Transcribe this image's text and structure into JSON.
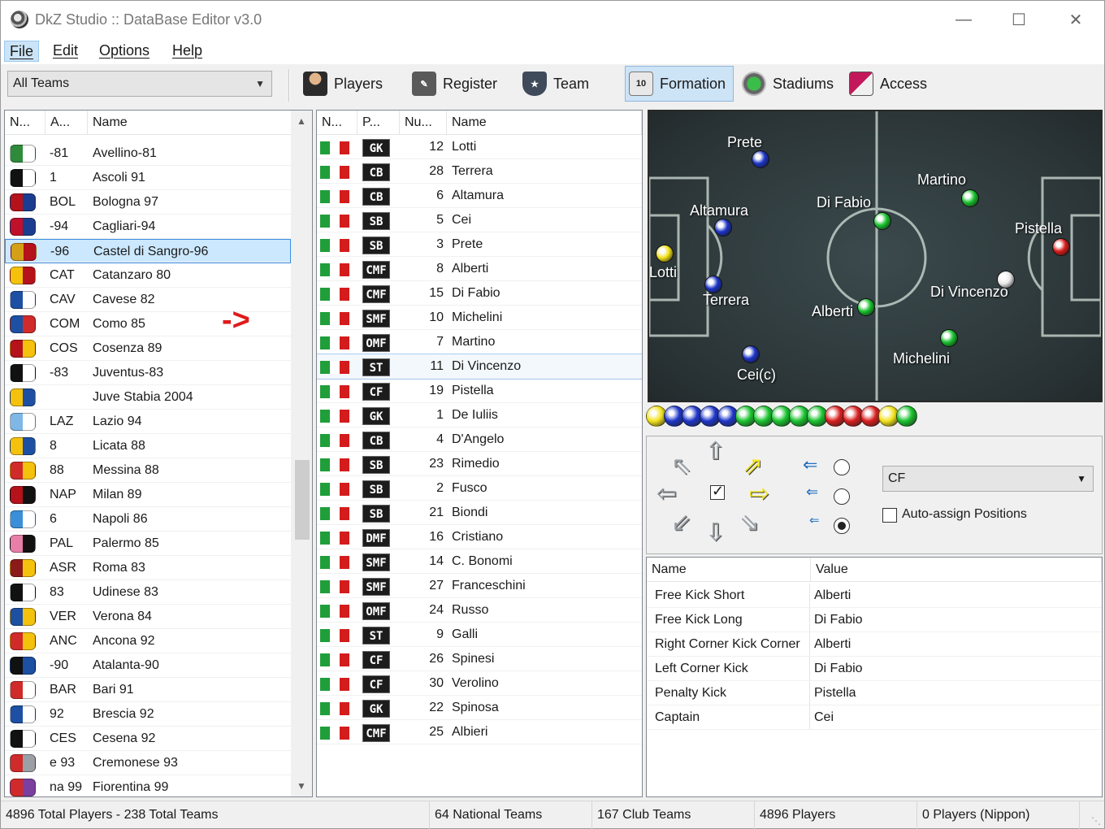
{
  "window": {
    "title": "DkZ Studio :: DataBase Editor v3.0",
    "minimize": "—",
    "maximize": "☐",
    "close": "✕"
  },
  "menu": [
    "File",
    "Edit",
    "Options",
    "Help"
  ],
  "toolbar": {
    "team_filter": "All Teams",
    "buttons": [
      {
        "label": "Players",
        "icon": "player-icon"
      },
      {
        "label": "Register",
        "icon": "register-icon"
      },
      {
        "label": "Team",
        "icon": "team-shield-icon"
      },
      {
        "label": "Formation",
        "icon": "formation-icon",
        "badge": "10",
        "pressed": true
      },
      {
        "label": "Stadiums",
        "icon": "stadium-icon"
      },
      {
        "label": "Access",
        "icon": "access-icon"
      }
    ]
  },
  "teams_table": {
    "columns": [
      "N...",
      "A...",
      "Name"
    ],
    "rows": [
      {
        "abbr": "-81",
        "name": "Avellino-81",
        "crest": [
          "#2e8b3a",
          "#ffffff"
        ]
      },
      {
        "abbr": "1",
        "name": "Ascoli 91",
        "crest": [
          "#111111",
          "#ffffff"
        ]
      },
      {
        "abbr": "BOL",
        "name": "Bologna 97",
        "crest": [
          "#b5121b",
          "#1b3d8f"
        ]
      },
      {
        "abbr": "-94",
        "name": "Cagliari-94",
        "crest": [
          "#c0102a",
          "#1b3d8f"
        ]
      },
      {
        "abbr": "-96",
        "name": "Castel di Sangro-96",
        "crest": [
          "#d4a017",
          "#b5121b"
        ],
        "selected": true
      },
      {
        "abbr": "CAT",
        "name": "Catanzaro 80",
        "crest": [
          "#f4c20d",
          "#b5121b"
        ]
      },
      {
        "abbr": "CAV",
        "name": "Cavese 82",
        "crest": [
          "#1d4fa3",
          "#ffffff"
        ]
      },
      {
        "abbr": "COM",
        "name": "Como 85",
        "crest": [
          "#1d4fa3",
          "#d12a2a"
        ]
      },
      {
        "abbr": "COS",
        "name": "Cosenza 89",
        "crest": [
          "#b5121b",
          "#f4c20d"
        ]
      },
      {
        "abbr": "-83",
        "name": "Juventus-83",
        "crest": [
          "#111111",
          "#ffffff"
        ]
      },
      {
        "abbr": "",
        "name": "Juve Stabia 2004",
        "crest": [
          "#f4c20d",
          "#1d4fa3"
        ]
      },
      {
        "abbr": "LAZ",
        "name": "Lazio 94",
        "crest": [
          "#7fb8e6",
          "#ffffff"
        ]
      },
      {
        "abbr": "8",
        "name": "Licata 88",
        "crest": [
          "#f4c20d",
          "#1d4fa3"
        ]
      },
      {
        "abbr": "88",
        "name": "Messina 88",
        "crest": [
          "#d12a2a",
          "#f4c20d"
        ]
      },
      {
        "abbr": "NAP",
        "name": "Milan 89",
        "crest": [
          "#b5121b",
          "#111111"
        ]
      },
      {
        "abbr": "6",
        "name": "Napoli 86",
        "crest": [
          "#3a8fd8",
          "#ffffff"
        ]
      },
      {
        "abbr": "PAL",
        "name": "Palermo 85",
        "crest": [
          "#e87fa8",
          "#111111"
        ]
      },
      {
        "abbr": "ASR",
        "name": "Roma 83",
        "crest": [
          "#8b1a1a",
          "#f4c20d"
        ]
      },
      {
        "abbr": "83",
        "name": "Udinese 83",
        "crest": [
          "#111111",
          "#ffffff"
        ]
      },
      {
        "abbr": "VER",
        "name": "Verona 84",
        "crest": [
          "#1d4fa3",
          "#f4c20d"
        ]
      },
      {
        "abbr": "ANC",
        "name": "Ancona 92",
        "crest": [
          "#d12a2a",
          "#f4c20d"
        ]
      },
      {
        "abbr": "-90",
        "name": "Atalanta-90",
        "crest": [
          "#111111",
          "#1d4fa3"
        ]
      },
      {
        "abbr": "BAR",
        "name": "Bari 91",
        "crest": [
          "#d12a2a",
          "#ffffff"
        ]
      },
      {
        "abbr": "92",
        "name": "Brescia 92",
        "crest": [
          "#1d4fa3",
          "#ffffff"
        ]
      },
      {
        "abbr": "CES",
        "name": "Cesena 92",
        "crest": [
          "#111111",
          "#ffffff"
        ]
      },
      {
        "abbr": "e 93",
        "name": "Cremonese 93",
        "crest": [
          "#d12a2a",
          "#9aa0a6"
        ]
      },
      {
        "abbr": "na 99",
        "name": "Fiorentina 99",
        "crest": [
          "#d12a2a",
          "#7b3fa0"
        ]
      }
    ]
  },
  "annotation_arrow": "->",
  "players_table": {
    "columns": [
      "N...",
      "P...",
      "Nu...",
      "Name"
    ],
    "rows": [
      {
        "pos": "GK",
        "num": "12",
        "name": "Lotti"
      },
      {
        "pos": "CB",
        "num": "28",
        "name": "Terrera"
      },
      {
        "pos": "CB",
        "num": "6",
        "name": "Altamura"
      },
      {
        "pos": "SB",
        "num": "5",
        "name": "Cei"
      },
      {
        "pos": "SB",
        "num": "3",
        "name": "Prete"
      },
      {
        "pos": "CMF",
        "num": "8",
        "name": "Alberti"
      },
      {
        "pos": "CMF",
        "num": "15",
        "name": "Di Fabio"
      },
      {
        "pos": "SMF",
        "num": "10",
        "name": "Michelini"
      },
      {
        "pos": "OMF",
        "num": "7",
        "name": "Martino"
      },
      {
        "pos": "ST",
        "num": "11",
        "name": "Di Vincenzo",
        "selected": true
      },
      {
        "pos": "CF",
        "num": "19",
        "name": "Pistella"
      },
      {
        "pos": "GK",
        "num": "1",
        "name": "De Iuliis"
      },
      {
        "pos": "CB",
        "num": "4",
        "name": "D'Angelo"
      },
      {
        "pos": "SB",
        "num": "23",
        "name": "Rimedio"
      },
      {
        "pos": "SB",
        "num": "2",
        "name": "Fusco"
      },
      {
        "pos": "SB",
        "num": "21",
        "name": "Biondi"
      },
      {
        "pos": "DMF",
        "num": "16",
        "name": "Cristiano"
      },
      {
        "pos": "SMF",
        "num": "14",
        "name": "C. Bonomi"
      },
      {
        "pos": "SMF",
        "num": "27",
        "name": "Franceschini"
      },
      {
        "pos": "OMF",
        "num": "24",
        "name": "Russo"
      },
      {
        "pos": "ST",
        "num": "9",
        "name": "Galli"
      },
      {
        "pos": "CF",
        "num": "26",
        "name": "Spinesi"
      },
      {
        "pos": "CF",
        "num": "30",
        "name": "Verolino"
      },
      {
        "pos": "GK",
        "num": "22",
        "name": "Spinosa"
      },
      {
        "pos": "CMF",
        "num": "25",
        "name": "Albieri"
      }
    ],
    "flag_colors": [
      "#1f9e3a",
      "#ffffff",
      "#d41c1c"
    ]
  },
  "formation": {
    "players": [
      {
        "label": "Prete",
        "color": "blue"
      },
      {
        "label": "Martino",
        "color": "green"
      },
      {
        "label": "Altamura",
        "color": "blue"
      },
      {
        "label": "Di Fabio",
        "color": "green"
      },
      {
        "label": "Pistella",
        "color": "red"
      },
      {
        "label": "Lotti",
        "color": "yellow"
      },
      {
        "label": "Terrera",
        "color": "blue"
      },
      {
        "label": "Alberti",
        "color": "green"
      },
      {
        "label": "Di Vincenzo",
        "color": "white"
      },
      {
        "label": "Michelini",
        "color": "green"
      },
      {
        "label": "Cei(c)",
        "color": "blue"
      }
    ],
    "color_balls": [
      "yellow",
      "blue",
      "blue",
      "blue",
      "blue",
      "green",
      "green",
      "green",
      "green",
      "green",
      "red",
      "red",
      "red",
      "yellow",
      "green"
    ],
    "palette": {
      "yellow": "#f2e21a",
      "blue": "#1d35c9",
      "green": "#19c22e",
      "red": "#d91d1d",
      "white": "#e8e8e8"
    }
  },
  "position_editor": {
    "selected_position": "CF",
    "auto_assign_label": "Auto-assign Positions",
    "auto_assign_checked": false,
    "center_checked": true,
    "radio_selected": 2
  },
  "set_pieces": {
    "columns": [
      "Name",
      "Value"
    ],
    "rows": [
      {
        "name": "Free Kick Short",
        "value": "Alberti"
      },
      {
        "name": "Free Kick Long",
        "value": "Di Fabio"
      },
      {
        "name": "Right Corner Kick Corner",
        "value": "Alberti"
      },
      {
        "name": "Left Corner Kick",
        "value": "Di Fabio"
      },
      {
        "name": "Penalty Kick",
        "value": "Pistella"
      },
      {
        "name": "Captain",
        "value": "Cei"
      }
    ]
  },
  "status": [
    "4896 Total Players  -  238 Total Teams",
    "64 National Teams",
    "167 Club Teams",
    "4896 Players",
    "0 Players (Nippon)"
  ]
}
